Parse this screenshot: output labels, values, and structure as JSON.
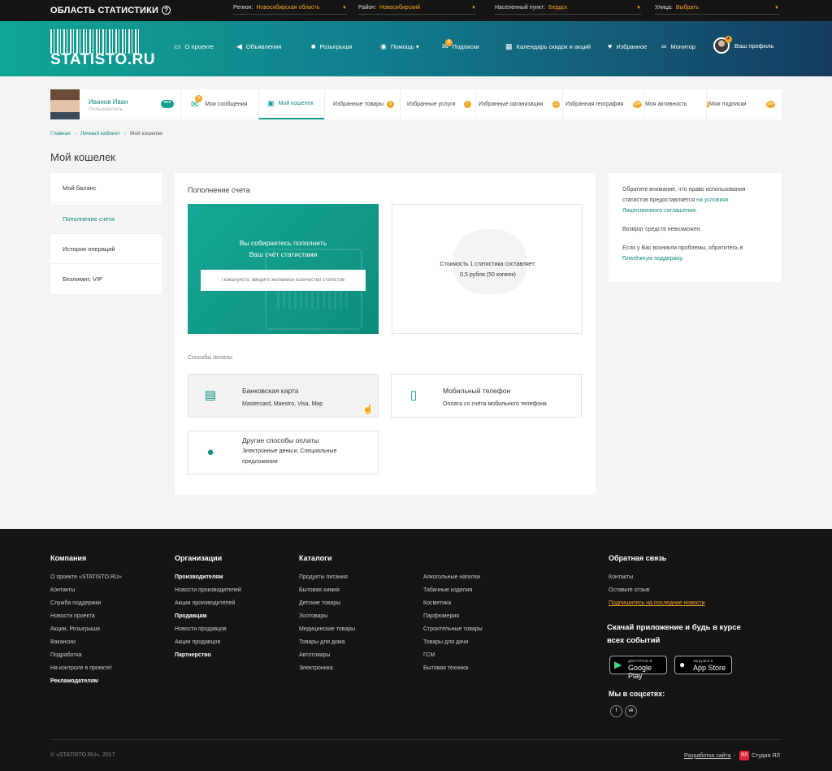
{
  "topbar": {
    "brand": "ОБЛАСТЬ СТАТИСТИКИ",
    "help_icon": "?",
    "region_label": "Регион:",
    "region_value": "Новосибирская область",
    "district_label": "Район:",
    "district_value": "Новосибирский",
    "locality_label": "Населенный пункт:",
    "locality_value": "Бердск",
    "street_label": "Улица:",
    "street_value": "Выбрать",
    "accent_color": "#f5a623"
  },
  "header": {
    "logo_text": "STATISTO.RU",
    "nav": [
      {
        "label": "О проекте",
        "icon": "monitor-icon"
      },
      {
        "label": "Объявления",
        "icon": "megaphone-icon"
      },
      {
        "label": "Розыгрыши",
        "icon": "gift-icon"
      },
      {
        "label": "Помощь",
        "icon": "help-icon"
      },
      {
        "label": "Подписки",
        "icon": "subscriptions-icon",
        "badge": "8"
      },
      {
        "label": "Календарь скидок и акций",
        "icon": "calendar-icon"
      },
      {
        "label": "Избранное",
        "icon": "heart-icon"
      },
      {
        "label": "Монитор",
        "icon": "binoculars-icon"
      },
      {
        "label": "Ваш профиль",
        "icon": "avatar"
      }
    ],
    "help_caret": "▾"
  },
  "profile": {
    "name": "Иванов Иван",
    "role": "Пользователь",
    "more": "•••",
    "tabs": [
      {
        "label": "Мои сообщения",
        "badge": "3"
      },
      {
        "label": "Мой кошелек",
        "active": true
      },
      {
        "label": "Избранные товары",
        "badge": "5"
      },
      {
        "label": "Избранные услуги",
        "badge": "7"
      },
      {
        "label": "Избранные организации",
        "badge": "12"
      },
      {
        "label": "Избранная география",
        "badge": "99+"
      },
      {
        "label": "Моя активность",
        "badge": "5"
      },
      {
        "label": "Мои подписки",
        "badge": "99+"
      }
    ]
  },
  "breadcrumb": [
    "Главная",
    "Личный кабинет",
    "Мой кошелек"
  ],
  "page_title": "Мой кошелек",
  "side_menu": [
    "Мой баланс",
    "Пополнение счета",
    "История операций",
    "Безлимит, VIP"
  ],
  "main": {
    "heading": "Пополнение счета",
    "topup_line1": "Вы собираетесь пополнить",
    "topup_line2": "Ваш счёт статистами",
    "input_placeholder": "Пожалуйста, введите желаемое количество статистов",
    "cost_line1": "Стоимость 1 статистика составляет:",
    "cost_line2": "0,5 рубля (50 копеек)",
    "payment_title": "Способы оплаты",
    "payments": [
      {
        "title": "Банковская карта",
        "sub": "Mastercard, Maestro, Visa, Мир",
        "icon": "card-icon"
      },
      {
        "title": "Мобильный телефон",
        "sub": "Оплата со счёта мобильного телефона",
        "icon": "phone-icon"
      },
      {
        "title": "Другие способы оплаты",
        "sub": "Электронные деньги; Специальные предложения",
        "icon": "wallet-icon"
      }
    ]
  },
  "info": {
    "p1_text": "Обратите внимание, что право использования статистов предоставляется ",
    "p1_link": "на условиях Лицензионного соглашения",
    "p1_end": ".",
    "p2": "Возврат средств невозможен.",
    "p3_text": "Если у Вас возникли проблемы, обратитесь в ",
    "p3_link": "Платёжную поддержку",
    "p3_end": "."
  },
  "footer": {
    "company_title": "Компания",
    "company_links": [
      "О проекте «STATISTO.RU»",
      "Контакты",
      "Служба поддержки",
      "Новости проекта",
      "Акции, Розыгрыши",
      "Вакансии",
      "Подработка",
      "На контроле в проекте!",
      "Рекламодателям"
    ],
    "org_title": "Организации",
    "org_links": [
      "Производителям",
      "Новости производителей",
      "Акции производителей",
      "Продавцам",
      "Новости продавцов",
      "Акции продавцов",
      "Партнерство"
    ],
    "catalog_title": "Каталоги",
    "catalog_col1": [
      "Продукты питания",
      "Бытовая химия",
      "Детские товары",
      "Зоотовары",
      "Медицинские товары",
      "Товары для дома",
      "Автотовары",
      "Электроника"
    ],
    "catalog_col2": [
      "Алкогольные напитки",
      "Табачные изделия",
      "Косметика",
      "Парфюмерия",
      "Строительные товары",
      "Товары для дачи",
      "ГСМ",
      "Бытовая техника"
    ],
    "feedback_title": "Обратная связь",
    "feedback_links": [
      "Контакты",
      "Оставьте отзыв",
      "Подпишитесь на последние новости"
    ],
    "app_title": "Скачай приложение и будь в курсе всех событий",
    "google_small": "ДОСТУПНО В",
    "google_big": "Google Play",
    "apple_small": "Загрузите в",
    "apple_big": "App Store",
    "social_title": "Мы в соцсетях:",
    "social_fb": "f",
    "social_vk": "vk",
    "copyright": "© «STATISTO.RU», 2017",
    "dev_link": "Разработка сайта",
    "dev_sep": "-",
    "studio_logo": "ЯЛ",
    "studio": "Студия ЯЛ"
  }
}
